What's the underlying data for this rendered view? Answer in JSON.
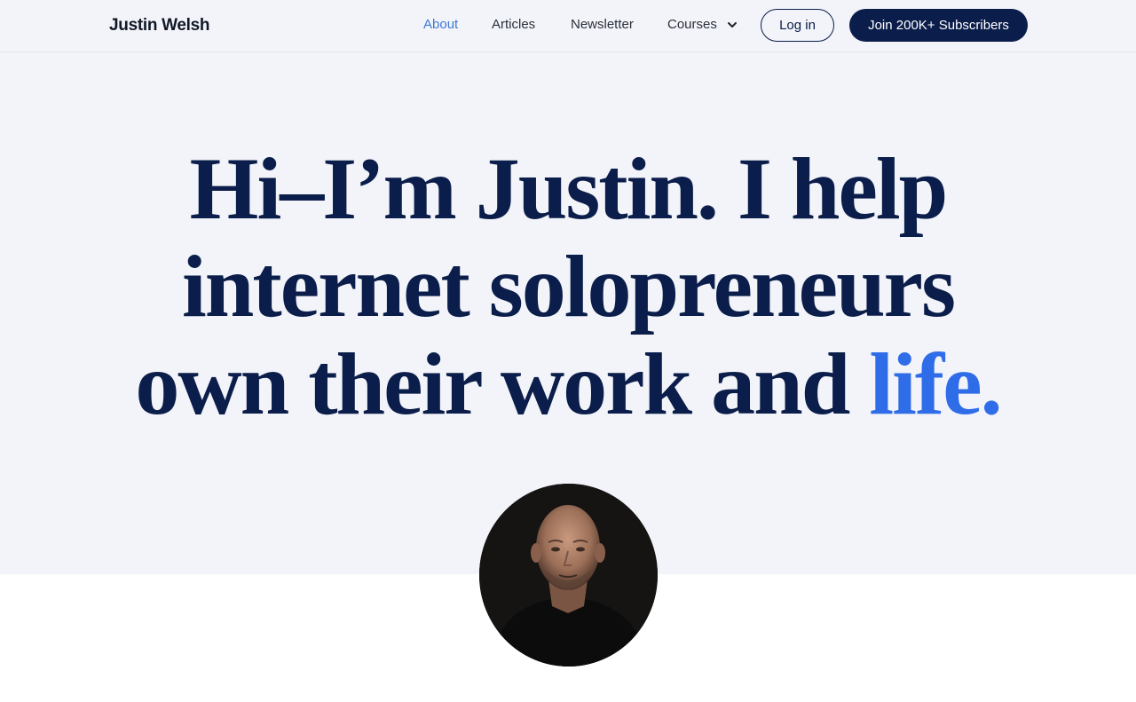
{
  "header": {
    "logo": "Justin Welsh",
    "nav": {
      "about": "About",
      "articles": "Articles",
      "newsletter": "Newsletter",
      "courses": "Courses"
    },
    "login": "Log in",
    "join": "Join 200K+ Subscribers"
  },
  "hero": {
    "line1": "Hi–I’m Justin. I help",
    "line2": "internet solopreneurs",
    "line3_main": "own their work and ",
    "line3_accent": "life."
  },
  "colors": {
    "navy": "#0b1d4a",
    "accent": "#2f6de8",
    "active_link": "#3f78d4",
    "hero_bg": "#f2f4f9"
  },
  "icons": {
    "courses_dropdown": "chevron-down-icon"
  }
}
